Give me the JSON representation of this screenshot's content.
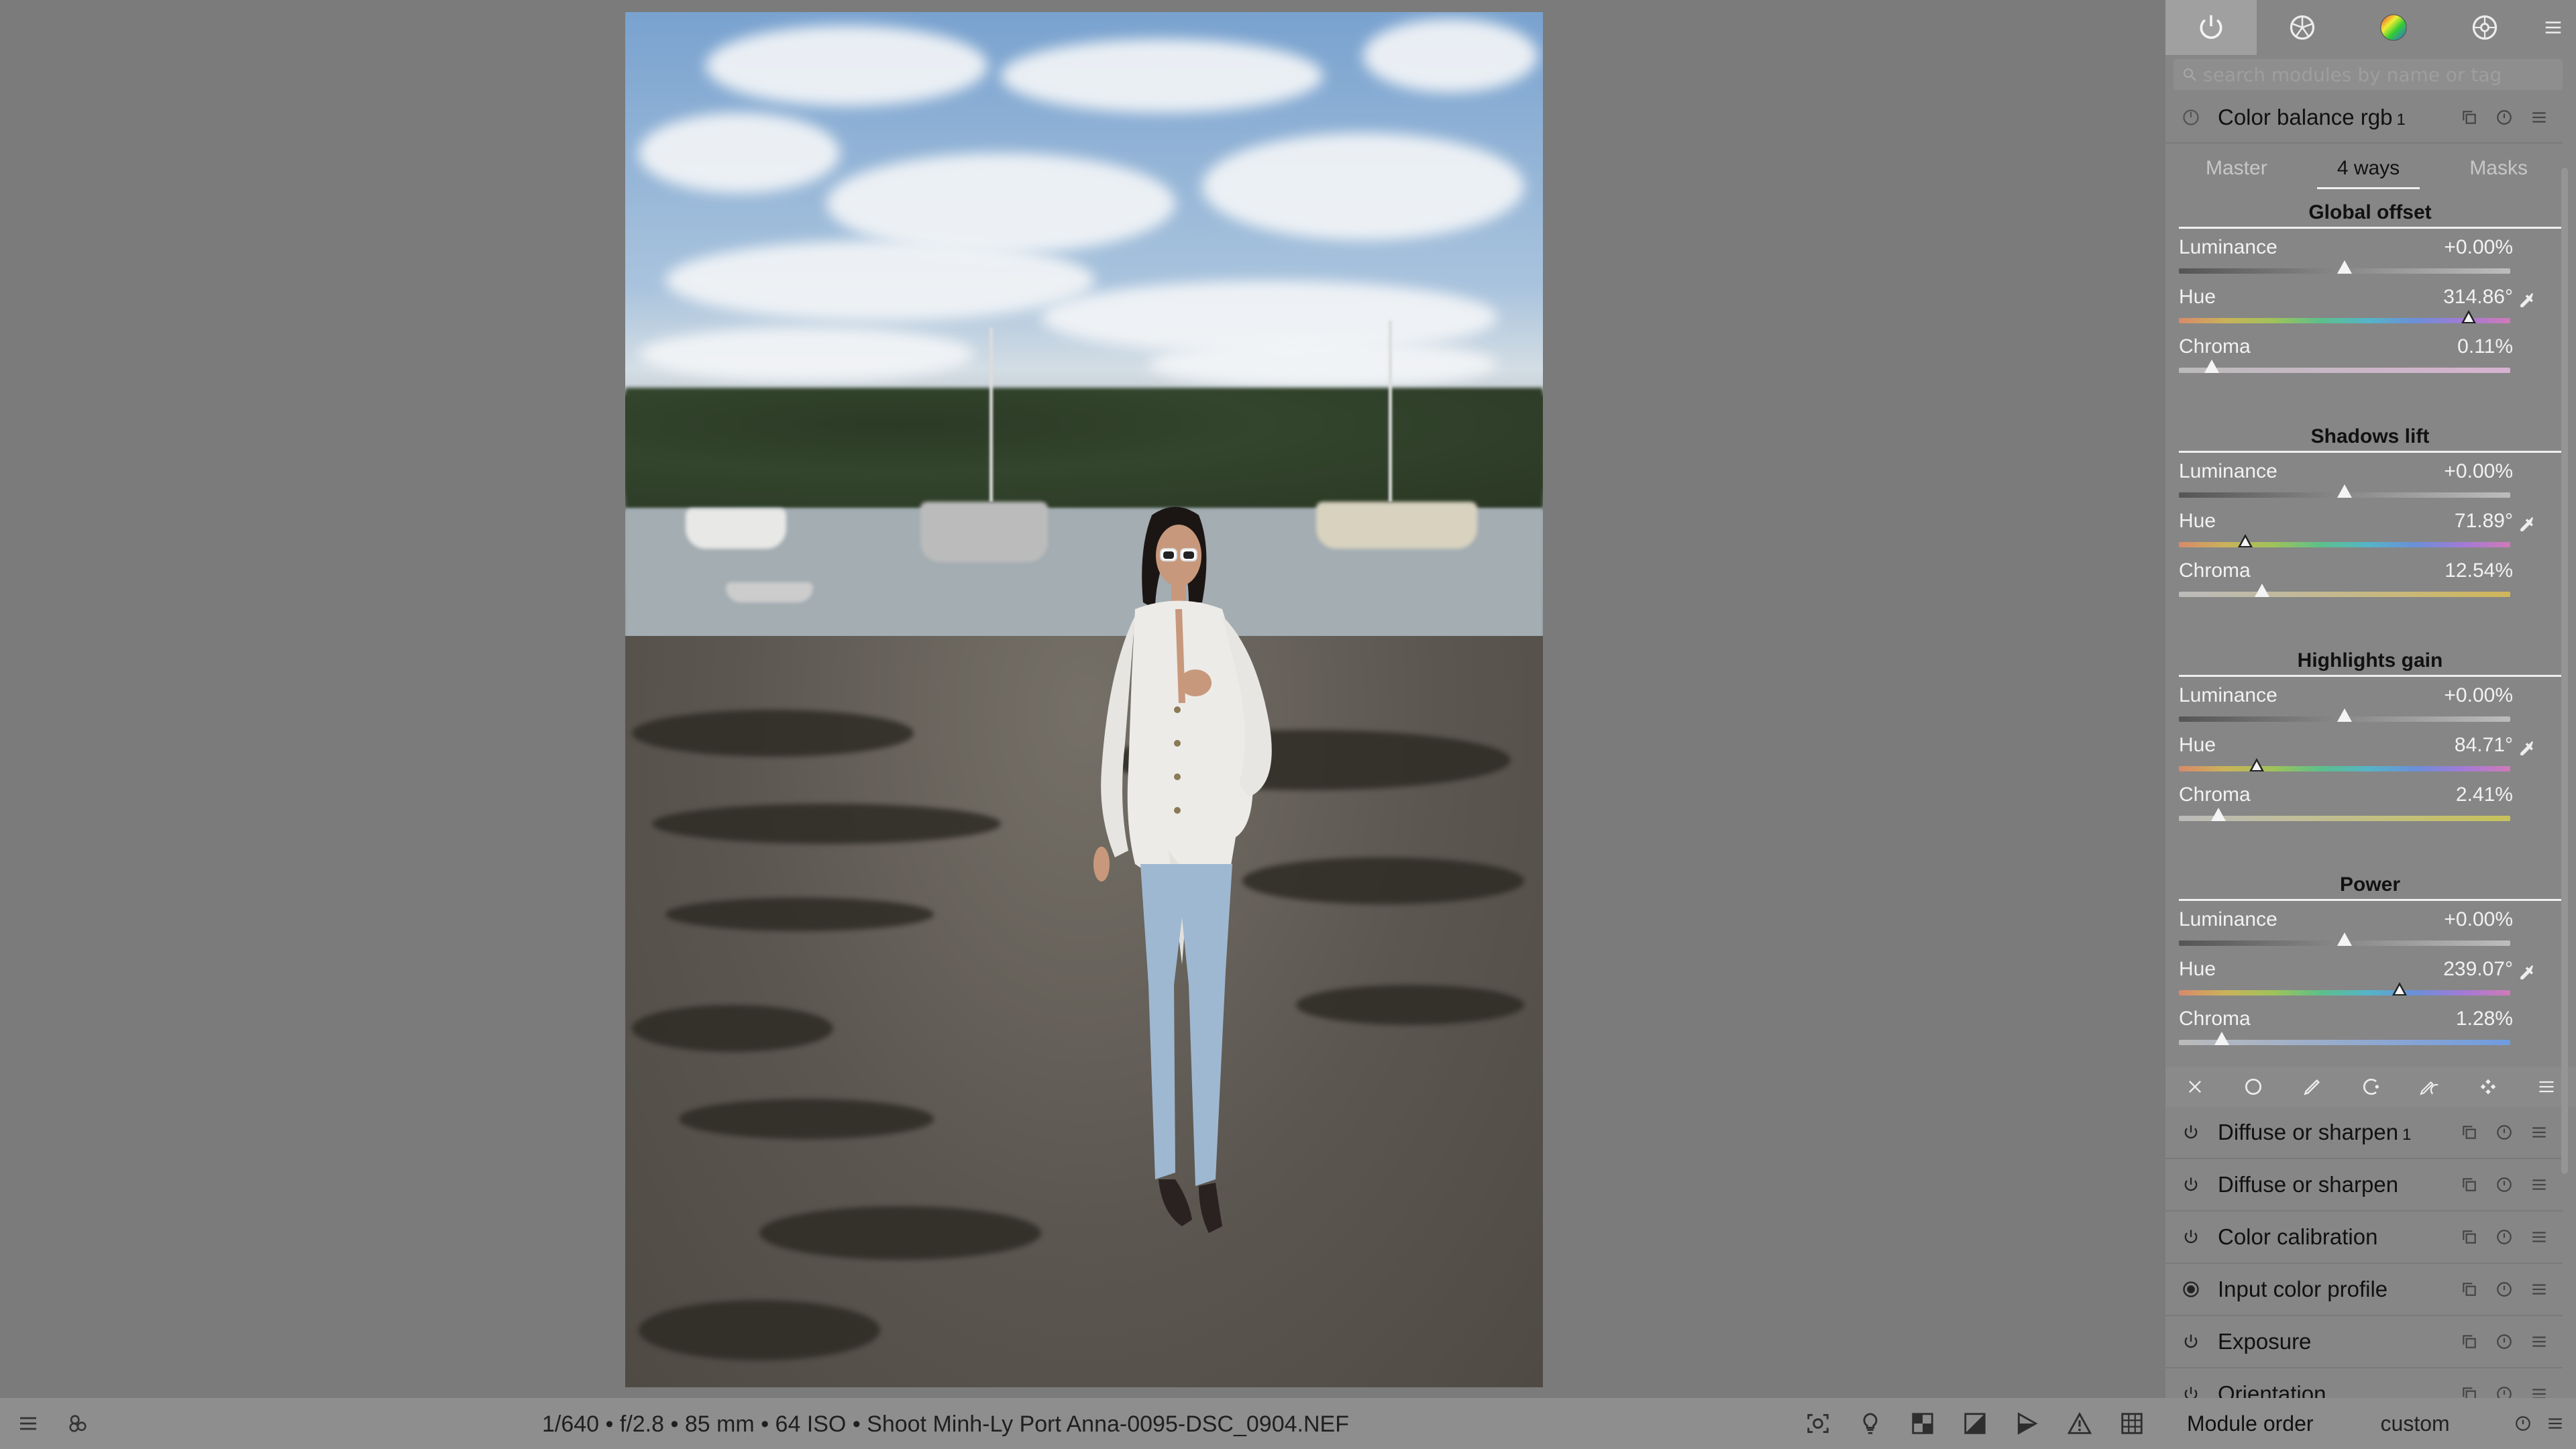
{
  "photo": {
    "alt": ""
  },
  "panel": {
    "tabs": [
      {
        "icon": "power-icon",
        "active": true
      },
      {
        "icon": "aperture-icon"
      },
      {
        "icon": "color-wheel-icon"
      },
      {
        "icon": "effects-icon"
      }
    ],
    "search_placeholder": "search modules by name or tag",
    "active_module": {
      "name": "Color balance rgb",
      "instance": "1",
      "subtabs": [
        "Master",
        "4 ways",
        "Masks"
      ],
      "active_subtab": "4 ways",
      "sections": [
        {
          "title": "Global offset",
          "rows": [
            {
              "label": "Luminance",
              "value": "+0.00%",
              "pos": 0.5
            },
            {
              "label": "Hue",
              "value": "314.86°",
              "pos": 0.875
            },
            {
              "label": "Chroma",
              "value": "0.11%",
              "pos": 0.1
            }
          ]
        },
        {
          "title": "Shadows lift",
          "rows": [
            {
              "label": "Luminance",
              "value": "+0.00%",
              "pos": 0.5
            },
            {
              "label": "Hue",
              "value": "71.89°",
              "pos": 0.2
            },
            {
              "label": "Chroma",
              "value": "12.54%",
              "pos": 0.25
            }
          ]
        },
        {
          "title": "Highlights gain",
          "rows": [
            {
              "label": "Luminance",
              "value": "+0.00%",
              "pos": 0.5
            },
            {
              "label": "Hue",
              "value": "84.71°",
              "pos": 0.235
            },
            {
              "label": "Chroma",
              "value": "2.41%",
              "pos": 0.12
            }
          ]
        },
        {
          "title": "Power",
          "rows": [
            {
              "label": "Luminance",
              "value": "+0.00%",
              "pos": 0.5
            },
            {
              "label": "Hue",
              "value": "239.07°",
              "pos": 0.665
            },
            {
              "label": "Chroma",
              "value": "1.28%",
              "pos": 0.13
            }
          ]
        }
      ]
    },
    "modules": [
      {
        "name": "Diffuse or sharpen",
        "instance": "1"
      },
      {
        "name": "Diffuse or sharpen",
        "instance": ""
      },
      {
        "name": "Color calibration",
        "instance": ""
      },
      {
        "name": "Input color profile",
        "instance": ""
      },
      {
        "name": "Exposure",
        "instance": ""
      },
      {
        "name": "Orientation",
        "instance": ""
      }
    ]
  },
  "bottom": {
    "info": "1/640 • f/2.8 • 85 mm • 64 ISO • Shoot Minh-Ly Port Anna-0095-DSC_0904.NEF",
    "module_order_label": "Module order",
    "module_order_value": "custom"
  },
  "colors": {
    "background": "#7b7b7b",
    "panel": "#868686",
    "active_tab": "#a0a0a0",
    "text_light": "#f2f2f2"
  }
}
